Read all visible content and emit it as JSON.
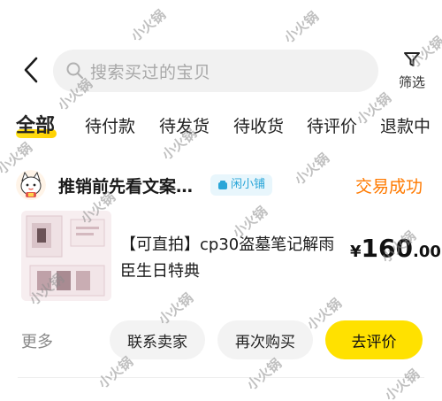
{
  "search": {
    "placeholder": "搜索买过的宝贝"
  },
  "filter": {
    "label": "筛选"
  },
  "tabs": [
    {
      "label": "全部"
    },
    {
      "label": "待付款"
    },
    {
      "label": "待发货"
    },
    {
      "label": "待收货"
    },
    {
      "label": "待评价"
    },
    {
      "label": "退款中"
    }
  ],
  "order": {
    "shop_name": "推销前先看文案…",
    "shop_badge": "闲小铺",
    "status": "交易成功",
    "product_title": "【可直拍】cp30盗墓笔记解雨臣生日特典",
    "price_symbol": "¥",
    "price_int": "160",
    "price_dec": ".00"
  },
  "actions": {
    "more": "更多",
    "contact_seller": "联系卖家",
    "buy_again": "再次购买",
    "review": "去评价"
  },
  "watermark": {
    "text": "小火锅"
  },
  "colors": {
    "accent_yellow": "#ffe100",
    "status_orange": "#ff7a00",
    "badge_blue": "#2aa6d8"
  },
  "icons": [
    "back-arrow-icon",
    "search-icon",
    "filter-icon",
    "shop-badge-icon",
    "cat-avatar-icon"
  ]
}
